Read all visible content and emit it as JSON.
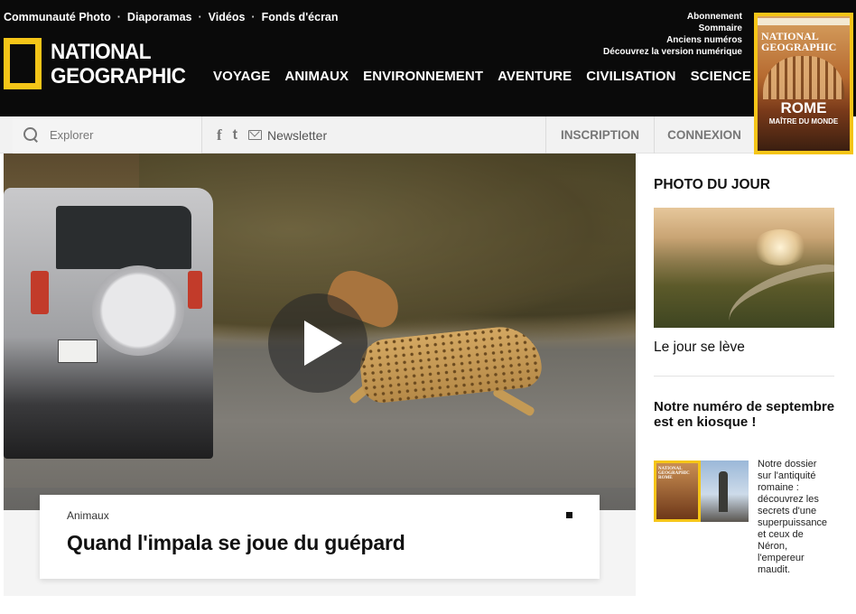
{
  "header": {
    "util_links": [
      "Communauté Photo",
      "Diaporamas",
      "Vidéos",
      "Fonds d'écran"
    ],
    "logo_line1": "NATIONAL",
    "logo_line2": "GEOGRAPHIC",
    "nav": [
      "VOYAGE",
      "ANIMAUX",
      "ENVIRONNEMENT",
      "AVENTURE",
      "CIVILISATION",
      "SCIENCE"
    ],
    "sub_links": [
      "Abonnement",
      "Sommaire",
      "Anciens numéros",
      "Découvrez la version numérique"
    ],
    "cover": {
      "title_line1": "NATIONAL",
      "title_line2": "GEOGRAPHIC",
      "headline": "ROME",
      "subhead": "MAÎTRE DU MONDE"
    },
    "brand_color": "#f5c518"
  },
  "toolbar": {
    "search_placeholder": "Explorer",
    "facebook": "f",
    "twitter": "t",
    "newsletter": "Newsletter",
    "inscription": "INSCRIPTION",
    "connexion": "CONNEXION"
  },
  "hero": {
    "category": "Animaux",
    "title": "Quand l'impala se joue du guépard"
  },
  "sidebar": {
    "photo_title": "PHOTO DU JOUR",
    "photo_caption": "Le jour se lève",
    "issue_title": "Notre numéro de septembre est en kiosque !",
    "issue_text": "Notre dossier sur l'antiquité romaine : découvrez les secrets d'une superpuissance et ceux de Néron, l'empereur maudit.",
    "thumb_line1": "NATIONAL",
    "thumb_line2": "GEOGRAPHIC",
    "thumb_headline": "ROME"
  }
}
